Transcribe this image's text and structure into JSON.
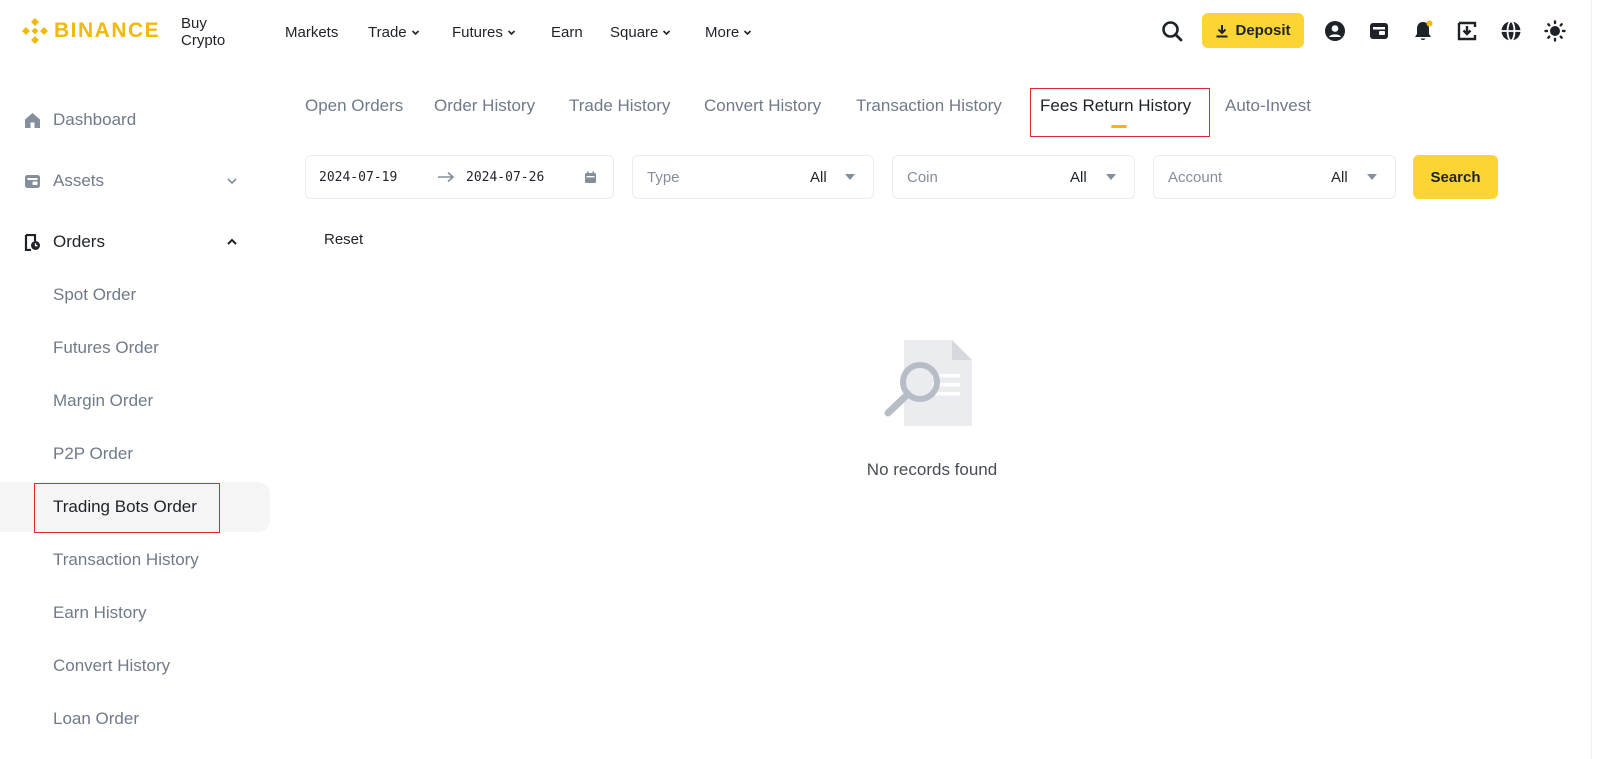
{
  "header": {
    "brand": "BINANCE",
    "nav": [
      {
        "label": "Buy Crypto",
        "dropdown": false
      },
      {
        "label": "Markets",
        "dropdown": false
      },
      {
        "label": "Trade",
        "dropdown": true
      },
      {
        "label": "Futures",
        "dropdown": true
      },
      {
        "label": "Earn",
        "dropdown": false
      },
      {
        "label": "Square",
        "dropdown": true
      },
      {
        "label": "More",
        "dropdown": true
      }
    ],
    "deposit_label": "Deposit",
    "icons": [
      "search-icon",
      "user-icon",
      "wallet-icon",
      "bell-icon",
      "download-app-icon",
      "globe-icon",
      "theme-icon"
    ],
    "accent_color": "#FCD535",
    "brand_color": "#F0B90B"
  },
  "sidebar": {
    "top_items": [
      {
        "label": "Dashboard",
        "icon": "home-icon"
      },
      {
        "label": "Assets",
        "icon": "wallet-icon",
        "expanded": false
      },
      {
        "label": "Orders",
        "icon": "orders-icon",
        "expanded": true
      }
    ],
    "sub_items": [
      {
        "label": "Spot Order"
      },
      {
        "label": "Futures Order"
      },
      {
        "label": "Margin Order"
      },
      {
        "label": "P2P Order"
      },
      {
        "label": "Trading Bots Order",
        "active": true
      },
      {
        "label": "Transaction History"
      },
      {
        "label": "Earn History"
      },
      {
        "label": "Convert History"
      },
      {
        "label": "Loan Order"
      }
    ]
  },
  "tabs": [
    {
      "label": "Open Orders"
    },
    {
      "label": "Order History"
    },
    {
      "label": "Trade History"
    },
    {
      "label": "Convert History"
    },
    {
      "label": "Transaction History"
    },
    {
      "label": "Fees Return History",
      "active": true
    },
    {
      "label": "Auto-Invest"
    }
  ],
  "filters": {
    "date_start": "2024-07-19",
    "date_end": "2024-07-26",
    "type": {
      "placeholder": "Type",
      "value": "All"
    },
    "coin": {
      "placeholder": "Coin",
      "value": "All"
    },
    "account": {
      "placeholder": "Account",
      "value": "All"
    },
    "search_label": "Search",
    "reset_label": "Reset"
  },
  "empty_state": {
    "message": "No records found",
    "icon": "no-records-icon"
  }
}
